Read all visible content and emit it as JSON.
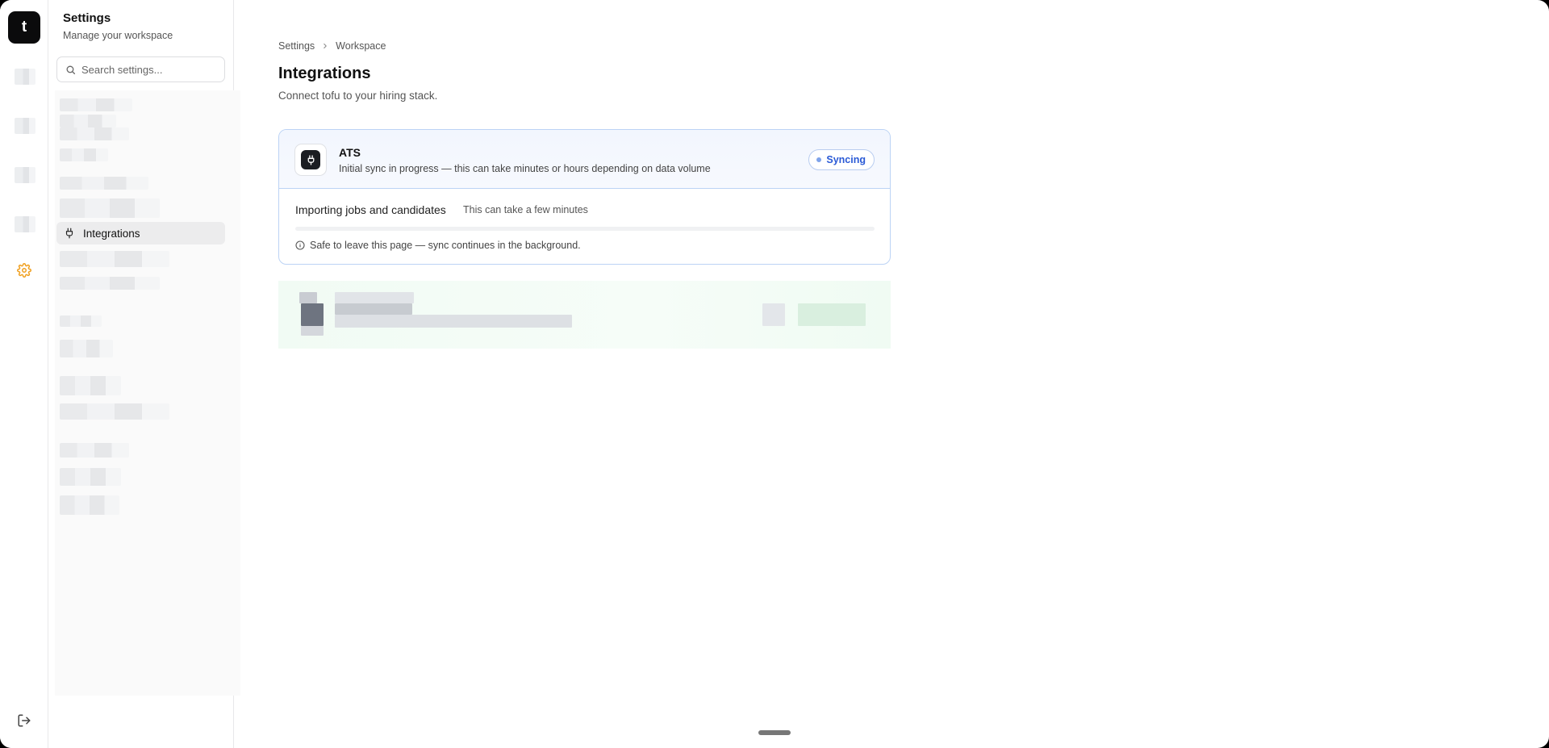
{
  "rail": {
    "logo_letter": "t"
  },
  "sidebar": {
    "title": "Settings",
    "subtitle": "Manage your workspace",
    "search_placeholder": "Search settings...",
    "active_item": "Integrations"
  },
  "breadcrumb": {
    "items": [
      "Settings",
      "Workspace"
    ]
  },
  "page": {
    "title": "Integrations",
    "description": "Connect tofu to your hiring stack."
  },
  "integration": {
    "name": "ATS",
    "status_text": "Initial sync in progress — this can take minutes or hours depending on data volume",
    "badge": "Syncing",
    "import_title": "Importing jobs and candidates",
    "import_subtitle": "This can take a few minutes",
    "progress_fraction": 0,
    "note": "Safe to leave this page — sync continues in the background."
  },
  "colors": {
    "accent": "#2a5ad6",
    "active_gear": "#f0a020",
    "card_border": "#bcd3f5"
  }
}
